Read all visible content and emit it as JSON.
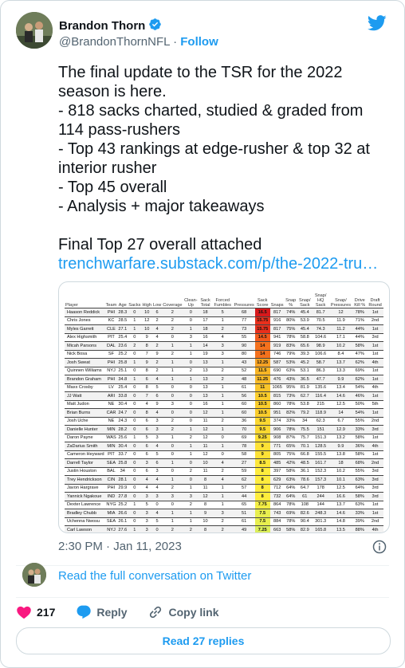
{
  "author": {
    "name": "Brandon Thorn",
    "handle": "@BrandonThornNFL",
    "follow_label": "Follow"
  },
  "tweet_lines": [
    "The final update to the TSR for the 2022",
    "season is here.",
    "- 818 sacks charted, studied & graded from",
    "114 pass-rushers",
    "- Top 43 rankings at edge-rusher & top 32 at",
    "interior rusher",
    "- Top 45 overall",
    "- Analysis + major takeaways",
    "",
    "Final Top 27 overall attached"
  ],
  "tweet_link": "trenchwarfare.substack.com/p/the-2022-tru…",
  "table": {
    "headers": [
      "Player",
      "Team",
      "Age",
      "Sacks",
      "High",
      "Low",
      "Coverage",
      "Clean-Up",
      "Sack Total",
      "Forced Fumbles",
      "Pressures",
      "Sack Score",
      "Snaps",
      "Snap %",
      "Snap/ Sack",
      "Snap/ HQ Sack",
      "Snap/ Pressures",
      "Drive Kill %",
      "Draft Round"
    ],
    "rows": [
      [
        "Haason Reddick",
        "PHI",
        "28.3",
        "0",
        "10",
        "6",
        "2",
        "0",
        "18",
        "5",
        "68",
        "16.5",
        "817",
        "74%",
        "45.4",
        "81.7",
        "12",
        "78%",
        "1st"
      ],
      [
        "Chris Jones",
        "KC",
        "28.5",
        "1",
        "12",
        "2",
        "2",
        "0",
        "17",
        "1",
        "77",
        "15.75",
        "916",
        "80%",
        "53.9",
        "70.5",
        "11.9",
        "71%",
        "2nd"
      ],
      [
        "Myles Garrett",
        "CLE",
        "27.1",
        "1",
        "10",
        "4",
        "2",
        "1",
        "18",
        "2",
        "73",
        "15.75",
        "817",
        "75%",
        "45.4",
        "74.3",
        "11.2",
        "44%",
        "1st"
      ],
      [
        "Alex Highsmith",
        "PIT",
        "25.4",
        "0",
        "9",
        "4",
        "0",
        "3",
        "16",
        "4",
        "55",
        "14.5",
        "941",
        "78%",
        "58.8",
        "104.6",
        "17.1",
        "44%",
        "3rd"
      ],
      [
        "Micah Parsons",
        "DAL",
        "23.6",
        "2",
        "8",
        "2",
        "1",
        "1",
        "14",
        "3",
        "90",
        "14",
        "919",
        "83%",
        "65.6",
        "98.9",
        "10.2",
        "58%",
        "1st"
      ],
      [
        "Nick Bosa",
        "SF",
        "25.2",
        "0",
        "7",
        "9",
        "2",
        "1",
        "19",
        "3",
        "80",
        "14",
        "746",
        "79%",
        "39.3",
        "106.6",
        "8.4",
        "47%",
        "1st"
      ],
      [
        "Josh Sweat",
        "PHI",
        "25.8",
        "1",
        "9",
        "2",
        "1",
        "0",
        "13",
        "1",
        "43",
        "12.25",
        "587",
        "53%",
        "45.2",
        "58.7",
        "13.7",
        "62%",
        "4th"
      ],
      [
        "Quinnen Williams",
        "NYJ",
        "25.1",
        "0",
        "8",
        "2",
        "1",
        "2",
        "13",
        "2",
        "52",
        "11.5",
        "690",
        "63%",
        "53.1",
        "86.3",
        "13.3",
        "69%",
        "1st"
      ],
      [
        "Brandon Graham",
        "PHI",
        "34.8",
        "1",
        "6",
        "4",
        "1",
        "1",
        "13",
        "2",
        "48",
        "11.25",
        "476",
        "43%",
        "36.5",
        "47.7",
        "9.9",
        "62%",
        "1st"
      ],
      [
        "Maxx Crosby",
        "LV",
        "25.4",
        "0",
        "8",
        "5",
        "0",
        "0",
        "13",
        "1",
        "61",
        "11",
        "1065",
        "95%",
        "81.9",
        "135.6",
        "13.4",
        "54%",
        "4th"
      ],
      [
        "JJ Watt",
        "ARI",
        "33.8",
        "0",
        "7",
        "6",
        "0",
        "0",
        "13",
        "1",
        "56",
        "10.5",
        "815",
        "73%",
        "62.7",
        "116.4",
        "14.6",
        "46%",
        "1st"
      ],
      [
        "Matt Judon",
        "NE",
        "30.4",
        "0",
        "4",
        "9",
        "3",
        "0",
        "16",
        "1",
        "60",
        "10.5",
        "860",
        "78%",
        "53.8",
        "215",
        "12.5",
        "50%",
        "5th"
      ],
      [
        "Brian Burns",
        "CAR",
        "24.7",
        "0",
        "8",
        "4",
        "0",
        "0",
        "12",
        "1",
        "60",
        "10.5",
        "951",
        "82%",
        "79.2",
        "118.9",
        "14",
        "54%",
        "1st"
      ],
      [
        "Josh Uche",
        "NE",
        "24.3",
        "0",
        "6",
        "3",
        "2",
        "0",
        "11",
        "2",
        "36",
        "9.5",
        "374",
        "33%",
        "34",
        "62.3",
        "6.7",
        "55%",
        "2nd"
      ],
      [
        "Danielle Hunter",
        "MIN",
        "28.2",
        "0",
        "6",
        "3",
        "2",
        "1",
        "12",
        "1",
        "70",
        "9.5",
        "906",
        "78%",
        "75.5",
        "151",
        "12.9",
        "33%",
        "3rd"
      ],
      [
        "Daron Payne",
        "WAS",
        "25.6",
        "1",
        "5",
        "3",
        "1",
        "2",
        "12",
        "0",
        "69",
        "9.25",
        "908",
        "87%",
        "75.7",
        "151.3",
        "13.2",
        "58%",
        "1st"
      ],
      [
        "ZaDarius Smith",
        "MIN",
        "30.4",
        "0",
        "6",
        "4",
        "0",
        "1",
        "11",
        "1",
        "78",
        "9",
        "771",
        "65%",
        "70.1",
        "128.5",
        "9.9",
        "36%",
        "4th"
      ],
      [
        "Cameron Heyward",
        "PIT",
        "33.7",
        "0",
        "6",
        "5",
        "0",
        "1",
        "12",
        "0",
        "58",
        "9",
        "805",
        "75%",
        "66.8",
        "155.5",
        "13.8",
        "58%",
        "1st"
      ],
      [
        "Darrell Taylor",
        "SEA",
        "25.8",
        "0",
        "3",
        "6",
        "1",
        "0",
        "10",
        "4",
        "27",
        "8.5",
        "485",
        "42%",
        "48.5",
        "161.7",
        "18",
        "68%",
        "2nd"
      ],
      [
        "Justin Houston",
        "BAL",
        "34",
        "0",
        "6",
        "3",
        "0",
        "2",
        "11",
        "2",
        "59",
        "8",
        "397",
        "58%",
        "36.1",
        "152.3",
        "10.2",
        "55%",
        "3rd"
      ],
      [
        "Trey Hendrickson",
        "CIN",
        "28.1",
        "0",
        "4",
        "4",
        "1",
        "0",
        "8",
        "4",
        "62",
        "8",
        "629",
        "63%",
        "78.6",
        "157.3",
        "10.1",
        "63%",
        "3rd"
      ],
      [
        "Javon Hargrave",
        "PHI",
        "29.9",
        "0",
        "4",
        "4",
        "2",
        "1",
        "11",
        "1",
        "57",
        "8",
        "712",
        "64%",
        "64.7",
        "178",
        "12.5",
        "64%",
        "3rd"
      ],
      [
        "Yannick Ngakoue",
        "IND",
        "27.8",
        "0",
        "3",
        "3",
        "3",
        "3",
        "12",
        "1",
        "44",
        "8",
        "732",
        "64%",
        "61",
        "244",
        "16.6",
        "58%",
        "3rd"
      ],
      [
        "Dexter Lawrence",
        "NYG",
        "25.2",
        "1",
        "5",
        "0",
        "0",
        "2",
        "8",
        "1",
        "65",
        "7.75",
        "864",
        "78%",
        "108",
        "144",
        "13.7",
        "63%",
        "1st"
      ],
      [
        "Bradley Chubb",
        "MIA",
        "26.6",
        "0",
        "3",
        "4",
        "1",
        "1",
        "9",
        "3",
        "51",
        "7.5",
        "743",
        "69%",
        "82.6",
        "248.3",
        "14.6",
        "33%",
        "1st"
      ],
      [
        "Uchenna Nwosu",
        "SEA",
        "26.1",
        "0",
        "3",
        "5",
        "1",
        "1",
        "10",
        "2",
        "61",
        "7.5",
        "884",
        "78%",
        "90.4",
        "301.3",
        "14.8",
        "39%",
        "2nd"
      ],
      [
        "Carl Lawson",
        "NYJ",
        "27.6",
        "1",
        "3",
        "0",
        "2",
        "2",
        "8",
        "2",
        "49",
        "7.25",
        "663",
        "58%",
        "82.9",
        "165.8",
        "13.5",
        "88%",
        "4th"
      ]
    ],
    "score_colors": [
      "#d7191c",
      "#e8301c",
      "#e8301c",
      "#f25a1d",
      "#f4711d",
      "#f4711d",
      "#f6a223",
      "#f8b525",
      "#f8ba27",
      "#f9c52a",
      "#facd2c",
      "#facd2c",
      "#facd2c",
      "#fbd831",
      "#fbd831",
      "#fcdd33",
      "#fde136",
      "#fde136",
      "#fde73a",
      "#feec3d",
      "#feec3d",
      "#feec3d",
      "#feec3d",
      "#f3ee45",
      "#e8ef4f",
      "#e8ef4f",
      "#dcef5a"
    ]
  },
  "timestamp": "2:30 PM · Jan 11, 2023",
  "conversation_link": "Read the full conversation on Twitter",
  "actions": {
    "likes": "217",
    "reply_label": "Reply",
    "copy_label": "Copy link"
  },
  "read_replies": "Read 27 replies",
  "colors": {
    "accent": "#1d9bf0",
    "like": "#f91880",
    "verified": "#1d9bf0"
  }
}
